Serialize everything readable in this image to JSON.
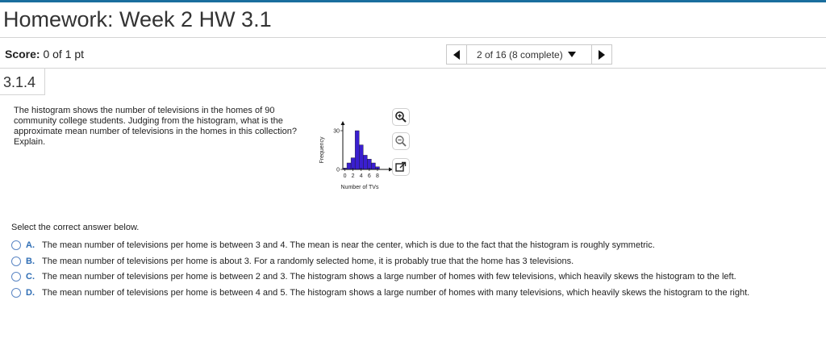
{
  "header": {
    "title": "Homework: Week 2 HW 3.1",
    "score_label": "Score:",
    "score_value": " 0 of 1 pt"
  },
  "nav": {
    "progress": "2 of 16 (8 complete)"
  },
  "question": {
    "number": "3.1.4",
    "text": "The histogram shows the number of televisions in the homes of 90 community college students. Judging from the histogram, what is the approximate mean number of televisions in the homes in this collection? Explain."
  },
  "chart_data": {
    "type": "bar",
    "x": [
      0,
      1,
      2,
      3,
      4,
      5,
      6,
      7,
      8
    ],
    "values": [
      1,
      5,
      9,
      30,
      19,
      11,
      8,
      5,
      2
    ],
    "xticks": [
      "0",
      "2",
      "4",
      "6",
      "8"
    ],
    "yticks": [
      "0",
      "30"
    ],
    "xlabel": "Number of TVs",
    "ylabel": "Frequency",
    "ylim": [
      0,
      35
    ],
    "xlim": [
      -0.5,
      9
    ],
    "bar_color": "#3a1fd0",
    "bar_edge_color": "#1a1a1a"
  },
  "tools": {
    "zoom_in": "zoom-in-icon",
    "zoom_out": "zoom-out-icon",
    "popout": "popout-icon"
  },
  "answers": {
    "prompt": "Select the correct answer below.",
    "options": [
      {
        "letter": "A.",
        "text": "The mean number of televisions per home is between 3 and 4. The mean is near the center, which is due to the fact that the histogram is roughly symmetric."
      },
      {
        "letter": "B.",
        "text": "The mean number of televisions per home is about 3. For a randomly selected home, it is probably true that the home has 3 televisions."
      },
      {
        "letter": "C.",
        "text": "The mean number of televisions per home is between 2 and 3. The histogram shows a large number of homes with few televisions, which heavily skews the histogram to the left."
      },
      {
        "letter": "D.",
        "text": "The mean number of televisions per home is between 4 and 5. The histogram shows a large number of homes with many televisions, which heavily skews the histogram to the right."
      }
    ]
  },
  "colors": {
    "accent": "#1a6e9e",
    "option_letter": "#2e6db4"
  }
}
